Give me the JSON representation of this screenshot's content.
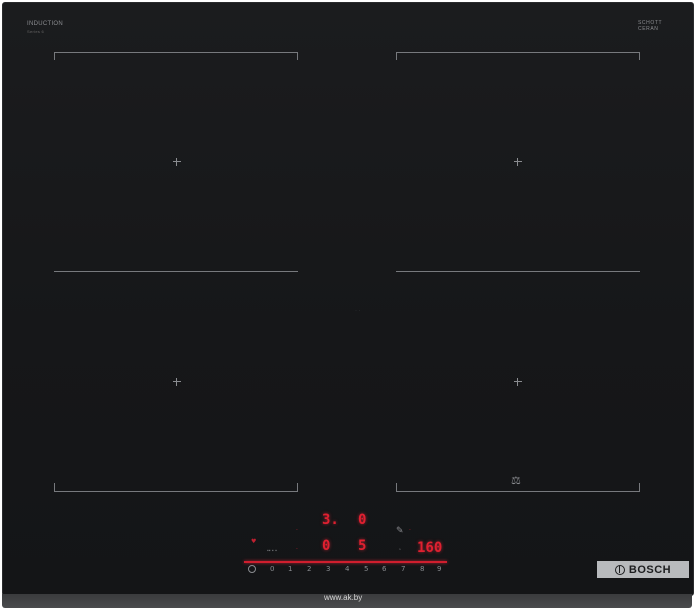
{
  "brand_top_left": {
    "line1": "INDUCTION",
    "line2": "Series 6"
  },
  "brand_top_right": {
    "line1": "SCHOTT",
    "line2": "CERAN",
    "line3": ""
  },
  "displays": {
    "top_left_value": "3.",
    "top_right_value": "0",
    "bottom_left_value": "0",
    "bottom_right_value": "5",
    "timer_value": "160"
  },
  "slider_labels": [
    "0",
    "1",
    "2",
    "3",
    "4",
    "5",
    "6",
    "7",
    "8",
    "9"
  ],
  "bosch_label": "BOSCH",
  "watermark": "www.ak.by",
  "icons": {
    "power": "power-icon",
    "move": "pan-move-icon",
    "pencil": "edit-icon"
  },
  "colors": {
    "display_red": "#e02030",
    "glass": "#161719",
    "zone_outline": "#77797d"
  }
}
